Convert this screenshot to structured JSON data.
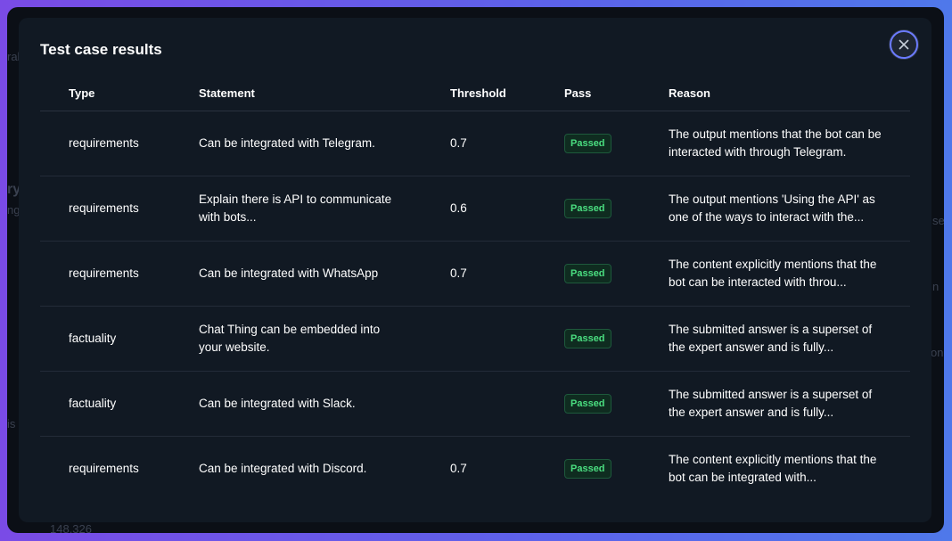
{
  "background": {
    "fragments": [
      "ral",
      "ry",
      "ng",
      "se",
      "n",
      "on",
      "is",
      "148,326"
    ]
  },
  "modal": {
    "title": "Test case results",
    "close_icon": "close-icon"
  },
  "table": {
    "headers": {
      "type": "Type",
      "statement": "Statement",
      "threshold": "Threshold",
      "pass": "Pass",
      "reason": "Reason"
    },
    "rows": [
      {
        "type": "requirements",
        "statement": "Can be integrated with Telegram.",
        "threshold": "0.7",
        "pass": "Passed",
        "reason": "The output mentions that the bot can be interacted with through Telegram."
      },
      {
        "type": "requirements",
        "statement": "Explain there is API to communicate with bots...",
        "threshold": "0.6",
        "pass": "Passed",
        "reason": "The output mentions 'Using the API' as one of the ways to interact with the..."
      },
      {
        "type": "requirements",
        "statement": "Can be integrated with WhatsApp",
        "threshold": "0.7",
        "pass": "Passed",
        "reason": "The content explicitly mentions that the bot can be interacted with throu..."
      },
      {
        "type": "factuality",
        "statement": "Chat Thing can be embedded into your website.",
        "threshold": "",
        "pass": "Passed",
        "reason": "The submitted answer is a superset of the expert answer and is fully..."
      },
      {
        "type": "factuality",
        "statement": "Can be integrated with Slack.",
        "threshold": "",
        "pass": "Passed",
        "reason": "The submitted answer is a superset of the expert answer and is fully..."
      },
      {
        "type": "requirements",
        "statement": "Can be integrated with Discord.",
        "threshold": "0.7",
        "pass": "Passed",
        "reason": "The content explicitly mentions that the bot can be integrated with..."
      }
    ]
  },
  "colors": {
    "modal_bg": "#111923",
    "badge_text": "#4ade80",
    "badge_bg": "#0f2c20",
    "close_ring": "#6b7bff"
  }
}
